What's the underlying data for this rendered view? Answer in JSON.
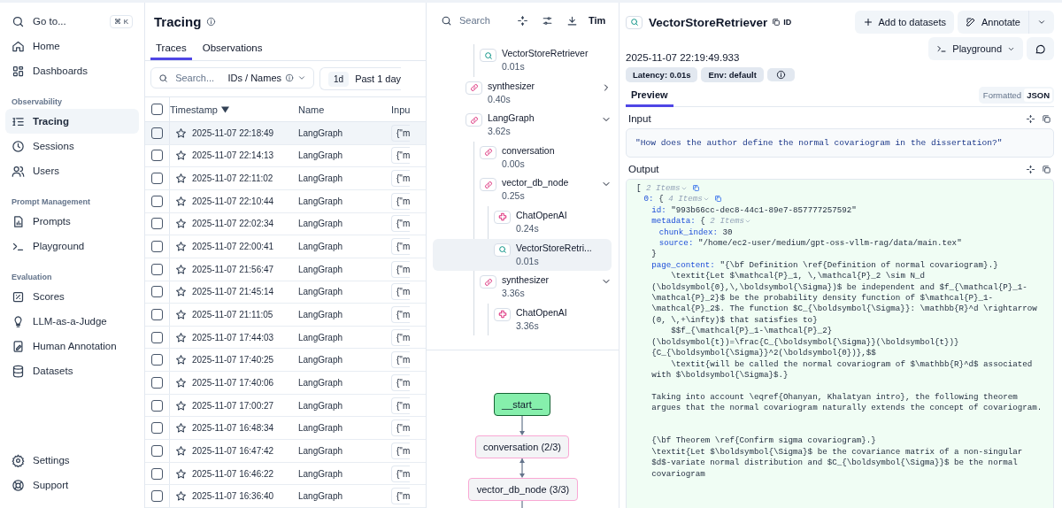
{
  "sidebar": {
    "search": {
      "label": "Go to...",
      "shortcut": "⌘ K"
    },
    "sections": [
      {
        "items": [
          {
            "label": "Home",
            "selected": false
          },
          {
            "label": "Dashboards",
            "selected": false
          }
        ]
      },
      {
        "title": "Observability",
        "items": [
          {
            "label": "Tracing",
            "selected": true
          },
          {
            "label": "Sessions",
            "selected": false
          },
          {
            "label": "Users",
            "selected": false
          }
        ]
      },
      {
        "title": "Prompt Management",
        "items": [
          {
            "label": "Prompts",
            "selected": false
          },
          {
            "label": "Playground",
            "selected": false
          }
        ]
      },
      {
        "title": "Evaluation",
        "items": [
          {
            "label": "Scores",
            "selected": false
          },
          {
            "label": "LLM-as-a-Judge",
            "selected": false
          },
          {
            "label": "Human Annotation",
            "selected": false
          },
          {
            "label": "Datasets",
            "selected": false
          }
        ]
      }
    ],
    "footer": [
      {
        "label": "Settings",
        "selected": false
      },
      {
        "label": "Support",
        "selected": false
      }
    ]
  },
  "page": {
    "title": "Tracing",
    "tabs": [
      {
        "label": "Traces",
        "selected": true
      },
      {
        "label": "Observations",
        "selected": false
      }
    ],
    "filter": {
      "search_placeholder": "Search...",
      "search_scope": "IDs / Names",
      "range_short": "1d",
      "range": "Past 1 day"
    },
    "table": {
      "select_all_checked": false,
      "columns": [
        {
          "label": "Timestamp",
          "sorted": true
        },
        {
          "label": "Name",
          "sorted": false
        },
        {
          "label": "Inpu",
          "sorted": false
        }
      ],
      "rows": [
        {
          "timestamp": "2025-11-07 22:18:49",
          "name": "LangGraph",
          "input": "{\"m",
          "checked": false,
          "starred": false,
          "selected": true
        },
        {
          "timestamp": "2025-11-07 22:14:13",
          "name": "LangGraph",
          "input": "{\"m",
          "checked": false,
          "starred": false,
          "selected": false
        },
        {
          "timestamp": "2025-11-07 22:11:02",
          "name": "LangGraph",
          "input": "{\"m",
          "checked": false,
          "starred": false,
          "selected": false
        },
        {
          "timestamp": "2025-11-07 22:10:44",
          "name": "LangGraph",
          "input": "{\"m",
          "checked": false,
          "starred": false,
          "selected": false
        },
        {
          "timestamp": "2025-11-07 22:02:34",
          "name": "LangGraph",
          "input": "{\"m",
          "checked": false,
          "starred": false,
          "selected": false
        },
        {
          "timestamp": "2025-11-07 22:00:41",
          "name": "LangGraph",
          "input": "{\"m",
          "checked": false,
          "starred": false,
          "selected": false
        },
        {
          "timestamp": "2025-11-07 21:56:47",
          "name": "LangGraph",
          "input": "{\"m",
          "checked": false,
          "starred": false,
          "selected": false
        },
        {
          "timestamp": "2025-11-07 21:45:14",
          "name": "LangGraph",
          "input": "{\"m",
          "checked": false,
          "starred": false,
          "selected": false
        },
        {
          "timestamp": "2025-11-07 21:11:05",
          "name": "LangGraph",
          "input": "{\"m",
          "checked": false,
          "starred": false,
          "selected": false
        },
        {
          "timestamp": "2025-11-07 17:44:03",
          "name": "LangGraph",
          "input": "{\"m",
          "checked": false,
          "starred": false,
          "selected": false
        },
        {
          "timestamp": "2025-11-07 17:40:25",
          "name": "LangGraph",
          "input": "{\"m",
          "checked": false,
          "starred": false,
          "selected": false
        },
        {
          "timestamp": "2025-11-07 17:40:06",
          "name": "LangGraph",
          "input": "{\"m",
          "checked": false,
          "starred": false,
          "selected": false
        },
        {
          "timestamp": "2025-11-07 17:00:27",
          "name": "LangGraph",
          "input": "{\"m",
          "checked": false,
          "starred": false,
          "selected": false
        },
        {
          "timestamp": "2025-11-07 16:48:34",
          "name": "LangGraph",
          "input": "{\"m",
          "checked": false,
          "starred": false,
          "selected": false
        },
        {
          "timestamp": "2025-11-07 16:47:42",
          "name": "LangGraph",
          "input": "{\"m",
          "checked": false,
          "starred": false,
          "selected": false
        },
        {
          "timestamp": "2025-11-07 16:46:22",
          "name": "LangGraph",
          "input": "{\"m",
          "checked": false,
          "starred": false,
          "selected": false
        },
        {
          "timestamp": "2025-11-07 16:36:40",
          "name": "LangGraph",
          "input": "{\"m",
          "checked": false,
          "starred": false,
          "selected": false
        }
      ]
    }
  },
  "trace_tree": {
    "search_placeholder": "Search",
    "column_label": "Tim",
    "nodes": [
      {
        "children": [
          {
            "name": "VectorStoreRetriever",
            "duration": "0.01s",
            "kind": "retriever",
            "selected": false
          }
        ]
      },
      {
        "name": "synthesizer",
        "duration": "0.40s",
        "kind": "chain",
        "selected": false,
        "expanded": false
      },
      {
        "name": "LangGraph",
        "duration": "3.62s",
        "kind": "chain",
        "selected": false,
        "expanded": true,
        "children": [
          {
            "name": "conversation",
            "duration": "0.00s",
            "kind": "chain",
            "selected": false
          },
          {
            "name": "vector_db_node",
            "duration": "0.25s",
            "kind": "chain",
            "selected": false,
            "expanded": true,
            "children": [
              {
                "name": "ChatOpenAI",
                "duration": "0.24s",
                "kind": "generation",
                "selected": false
              },
              {
                "name": "VectorStoreRetri...",
                "duration": "0.01s",
                "kind": "retriever",
                "selected": true
              }
            ]
          },
          {
            "name": "synthesizer",
            "duration": "3.36s",
            "kind": "chain",
            "selected": false,
            "expanded": true,
            "children": [
              {
                "name": "ChatOpenAI",
                "duration": "3.36s",
                "kind": "generation",
                "selected": false
              }
            ]
          }
        ]
      }
    ]
  },
  "graph": {
    "nodes": [
      {
        "label": "__start__",
        "kind": "start"
      },
      {
        "label": "conversation (2/3)",
        "kind": "node"
      },
      {
        "label": "vector_db_node (3/3)",
        "kind": "node"
      }
    ]
  },
  "detail": {
    "kind": "retriever",
    "title": "VectorStoreRetriever",
    "id_label": "ID",
    "actions": [
      "Add to datasets",
      "Annotate"
    ],
    "playground": "Playground",
    "timestamp": "2025-11-07 22:19:49.933",
    "badges": [
      "Latency: 0.01s",
      "Env: default"
    ],
    "tabs": [
      {
        "label": "Preview",
        "selected": true
      }
    ],
    "view_modes": [
      {
        "label": "Formatted",
        "selected": false
      },
      {
        "label": "JSON",
        "selected": true
      }
    ],
    "input": {
      "label": "Input",
      "text": "\"How does the author define the normal covariogram in the dissertation?\""
    },
    "output": {
      "label": "Output",
      "json": {
        "open": "[",
        "count": "2 Items",
        "copyable": true,
        "children": [
          {
            "key": "0:",
            "open": "{",
            "count": "4 Items",
            "copyable": true,
            "children": [
              {
                "key": "id:",
                "value": "\"993b66cc-dec8-44c1-89e7-857777257592\""
              },
              {
                "key": "metadata:",
                "open": "{",
                "count": "2 Items",
                "copyable": false,
                "close": "}",
                "children": [
                  {
                    "key": "chunk_index:",
                    "value": "30"
                  },
                  {
                    "key": "source:",
                    "value": "\"/home/ec2-user/medium/gpt-oss-vllm-rag/data/main.tex\""
                  }
                ]
              },
              {
                "key": "page_content:",
                "value": "\"{\\bf Definition \\ref{Definition of normal covariogram}.}\n    \\textit{Let $\\mathcal{P}_1, \\,\\mathcal{P}_2 \\sim N_d (\\boldsymbol{0},\\,\\boldsymbol{\\Sigma})$ be independent and $f_{\\mathcal{P}_1-\\mathcal{P}_2}$ be the probability density function of $\\mathcal{P}_1-\\mathcal{P}_2$. The function $C_{\\boldsymbol{\\Sigma}}: \\mathbb{R}^d \\rightarrow (0, \\,+\\infty)$ that satisfies to}\n    $$f_{\\mathcal{P}_1-\\mathcal{P}_2}(\\boldsymbol{t})=\\frac{C_{\\boldsymbol{\\Sigma}}(\\boldsymbol{t})}{C_{\\boldsymbol{\\Sigma}}^2(\\boldsymbol{0})},$$\n    \\textit{will be called the normal covariogram of $\\mathbb{R}^d$ associated with $\\boldsymbol{\\Sigma}$.}\n\nTaking into account \\eqref{Ohanyan, Khalatyan intro}, the following theorem argues that the normal covariogram naturally extends the concept of covariogram.\n\n\n{\\bf Theorem \\ref{Confirm sigma covariogram}.}\n\\textit{Let $\\boldsymbol{\\Sigma}$ be the covariance matrix of a non-singular $d$-variate normal distribution and $C_{\\boldsymbol{\\Sigma}}$ be the normal covariogram"
              }
            ]
          }
        ]
      }
    }
  }
}
